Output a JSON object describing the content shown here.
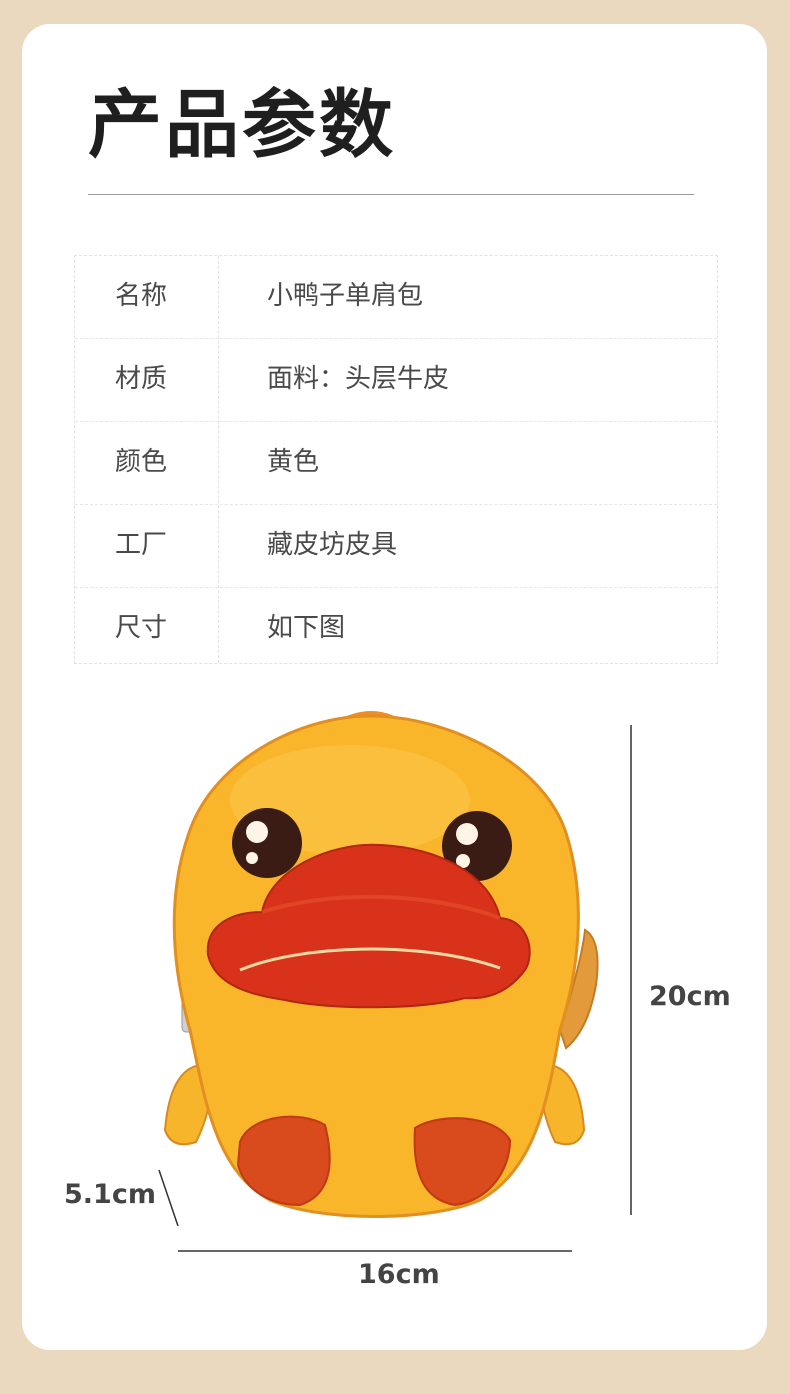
{
  "title": "产品参数",
  "specs": [
    {
      "key": "名称",
      "value": "小鸭子单肩包"
    },
    {
      "key": "材质",
      "value": "面料：头层牛皮"
    },
    {
      "key": "颜色",
      "value": "黄色"
    },
    {
      "key": "工厂",
      "value": "藏皮坊皮具"
    },
    {
      "key": "尺寸",
      "value": "如下图"
    }
  ],
  "dimensions": {
    "height": "20cm",
    "width": "16cm",
    "depth": "5.1cm"
  },
  "colors": {
    "background": "#ead9bf",
    "card": "#ffffff",
    "duck_body": "#f7b52c",
    "duck_beak": "#d8331a"
  }
}
